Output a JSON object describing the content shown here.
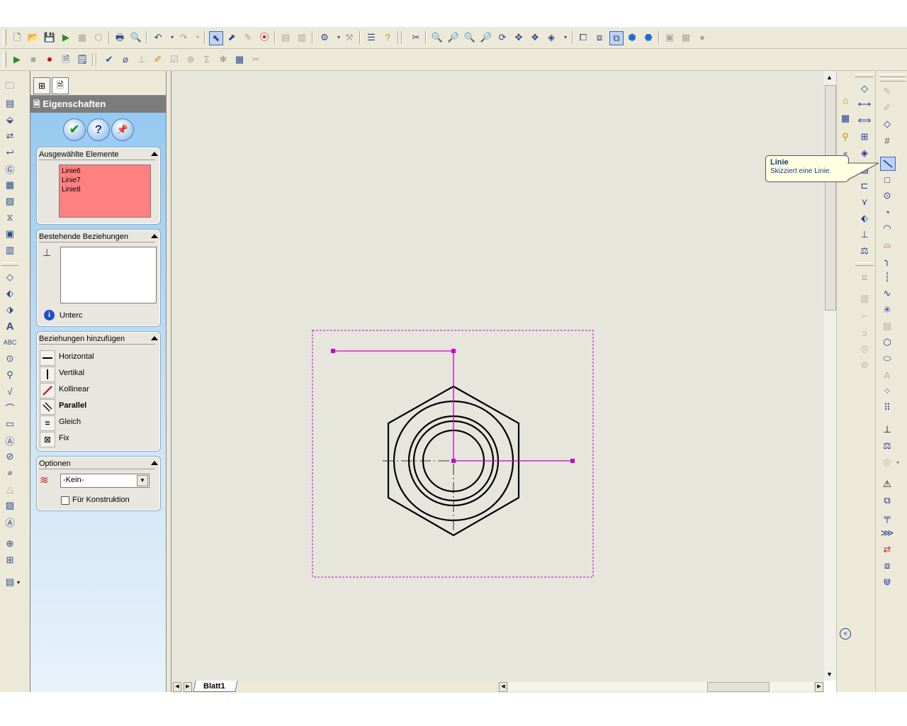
{
  "toolbar_main": {
    "icons": [
      "new-file-icon",
      "open-icon",
      "save-icon",
      "run-icon",
      "print-icon",
      "print-preview-icon",
      "undo-icon",
      "redo-icon",
      "select-icon",
      "smart-select-icon",
      "sketch-icon",
      "traffic-light-icon",
      "options-icon",
      "help-icon",
      "zoom-fit-icon",
      "zoom-area-icon",
      "zoom-in-out-icon",
      "zoom-selection-icon",
      "rotate-icon",
      "pan-icon",
      "view-orientation-icon",
      "display-style-icon",
      "front-view-icon",
      "back-view-icon",
      "iso-view-icon",
      "shaded-icon"
    ]
  },
  "toolbar_second": {
    "icons": [
      "play-icon",
      "stop-icon",
      "record-icon",
      "new-macro-icon",
      "edit-macro-icon",
      "spell-check-icon",
      "dimension-icon",
      "balloon-icon",
      "note-icon",
      "sum-icon",
      "table-icon"
    ]
  },
  "property_manager": {
    "title": "Eigenschaften",
    "buttons": {
      "ok": "✔",
      "help": "?",
      "pin": "📌"
    },
    "selected": {
      "header": "Ausgewählte Elemente",
      "items": [
        "Linie6",
        "Linie7",
        "Linie8"
      ]
    },
    "existing": {
      "header": "Bestehende Beziehungen",
      "info": "Unterc"
    },
    "add_relations": {
      "header": "Beziehungen hinzufügen",
      "items": [
        {
          "label": "Horizontal",
          "icon": "horizontal-icon"
        },
        {
          "label": "Vertikal",
          "icon": "vertical-icon"
        },
        {
          "label": "Kollinear",
          "icon": "collinear-icon"
        },
        {
          "label": "Parallel",
          "icon": "parallel-icon"
        },
        {
          "label": "Gleich",
          "icon": "equal-icon"
        },
        {
          "label": "Fix",
          "icon": "fix-icon"
        }
      ]
    },
    "options": {
      "header": "Optionen",
      "layer_value": "-Kein-",
      "construction_label": "Für Konstruktion",
      "construction_checked": false
    }
  },
  "sheet_tab": "Blatt1",
  "tooltip": {
    "title": "Linie",
    "text": "Skizziert eine Linie."
  },
  "colors": {
    "sketch_selected": "#cc00cc",
    "selection_list_bg": "#ff8080",
    "canvas_bg": "#e6e6dc",
    "panel_blue": "#8ec6f0"
  }
}
